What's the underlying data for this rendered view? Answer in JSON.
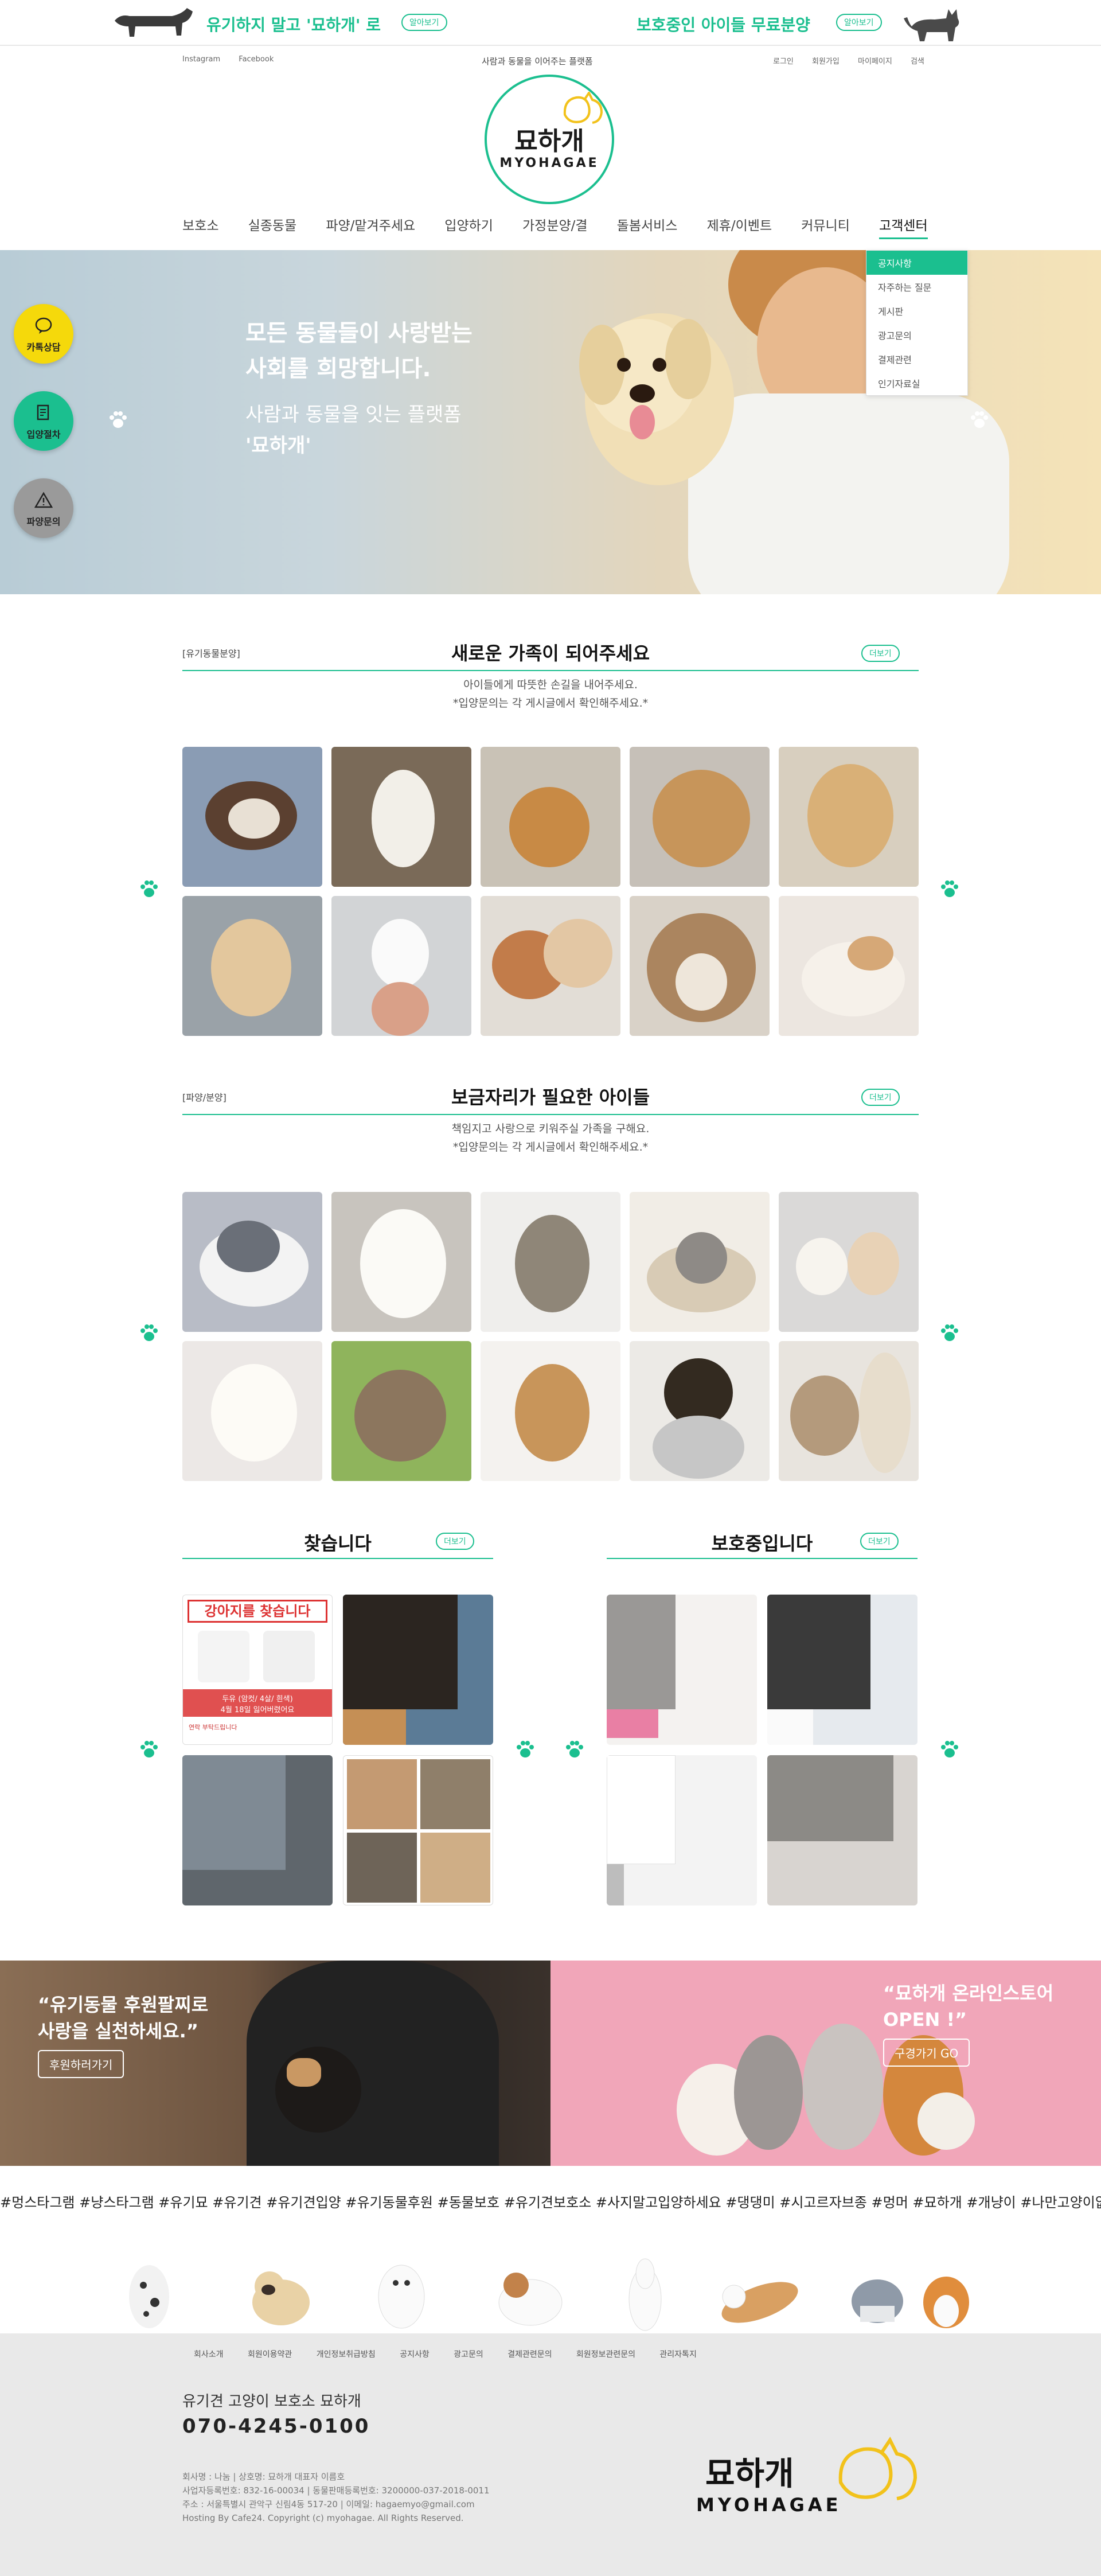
{
  "topbar": {
    "left_message": "유기하지 말고 '묘하개' 로",
    "left_button": "알아보기",
    "right_message": "보호중인 아이들 무료분양",
    "right_button": "알아보기"
  },
  "util_left": [
    "Instagram",
    "Facebook"
  ],
  "tagline": "사람과 동물을 이어주는 플랫폼",
  "util_right": [
    "로그인",
    "회원가입",
    "마이페이지",
    "검색"
  ],
  "logo": {
    "ko": "묘하개",
    "en": "MYOHAGAE"
  },
  "nav": [
    "보호소",
    "실종동물",
    "파양/맡겨주세요",
    "입양하기",
    "가정분양/결",
    "돌봄서비스",
    "제휴/이벤트",
    "커뮤니티",
    "고객센터"
  ],
  "dropdown": [
    "공지사항",
    "자주하는 질문",
    "게시판",
    "광고문의",
    "결제관련",
    "인기자료실"
  ],
  "hero": {
    "line1a": "모든 동물들이 사랑받는",
    "line1b": "사회를 희망합니다.",
    "line2a": "사람과 동물을 잇는 플랫폼",
    "line2b": "'묘하개'"
  },
  "floating": [
    "카톡상담",
    "입양절차",
    "파양문의"
  ],
  "section1": {
    "tag": "[유기동물분양]",
    "title": "새로운 가족이 되어주세요",
    "more": "더보기",
    "desc1": "아이들에게 따뜻한 손길을 내어주세요.",
    "desc2": "*입양문의는 각 게시글에서 확인해주세요.*"
  },
  "section2": {
    "tag": "[파양/분양]",
    "title": "보금자리가 필요한 아이들",
    "more": "더보기",
    "desc1": "책임지고 사랑으로 키워주실 가족을 구해요.",
    "desc2": "*입양문의는 각 게시글에서 확인해주세요.*"
  },
  "section3": {
    "left_title": "찾습니다",
    "right_title": "보호중입니다",
    "more": "더보기",
    "poster_title": "강아지를 찾습니다",
    "poster_label": "두유 (암컷/ 4살/ 흰색)",
    "poster_desc": "4월 18일 잃어버렸어요",
    "poster_info": "연락 부탁드립니다"
  },
  "promo_left": {
    "line1": "“유기동물 후원팔찌로",
    "line2": "사랑을 실천하세요.”",
    "button": "후원하러가기"
  },
  "promo_right": {
    "line1": "“묘하개 온라인스토어",
    "line2": "OPEN !”",
    "button": "구경가기 GO"
  },
  "hashtags": "#멍스타그램 #냥스타그램 #유기묘 #유기견 #유기견입양 #유기동물후원 #동물보호 #유기견보호소 #사지말고입양하세요 #댕댕미 #시고르자브종 #멍머 #묘하개 #개냥이 #나만고양이없어",
  "footer": {
    "links": [
      "회사소개",
      "회원이용약관",
      "개인정보취급방침",
      "공지사항",
      "광고문의",
      "결제관련문의",
      "회원정보관련문의",
      "관리자톡지"
    ],
    "company": "유기견 고양이 보호소 묘하개",
    "phone": "070-4245-0100",
    "info1": "회사명 : 나눔 | 상호명: 묘하개 대표자 이름호",
    "info2": "사업자등록번호: 832-16-00034 | 동물판매등록번호: 3200000-037-2018-0011",
    "info3": "주소 : 서울특별시 관악구 신림4동 517-20 | 이메일: hagaemyo@gmail.com",
    "info4": "Hosting By Cafe24. Copyright (c) myohagae. All Rights Reserved.",
    "logo_ko": "묘하개",
    "logo_en": "MYOHAGAE"
  },
  "colors": {
    "accent": "#1bbf8f",
    "float_yellow": "#f5d90b",
    "float_green": "#1bbf8f",
    "float_gray": "#9a9a9a"
  }
}
